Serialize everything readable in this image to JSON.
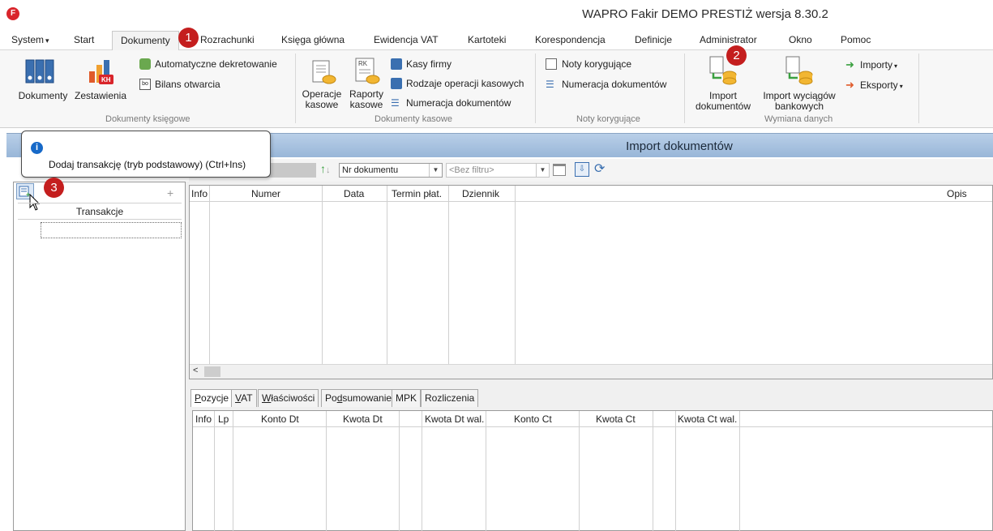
{
  "window": {
    "title": "WAPRO Fakir DEMO PRESTIŻ wersja 8.30.2"
  },
  "menu": {
    "items": [
      "System",
      "Start",
      "Dokumenty",
      "Rozrachunki",
      "Księga główna",
      "Ewidencja VAT",
      "Kartoteki",
      "Korespondencja",
      "Definicje",
      "Administrator",
      "Okno",
      "Pomoc"
    ],
    "system_arrow": "▾"
  },
  "ribbon": {
    "dokumenty_ksiegowe": {
      "label": "Dokumenty księgowe",
      "btn_dokumenty": "Dokumenty",
      "btn_zestawienia": "Zestawienia",
      "auto_dekretowanie": "Automatyczne dekretowanie",
      "bilans_otwarcia": "Bilans otwarcia"
    },
    "dokumenty_kasowe": {
      "label": "Dokumenty kasowe",
      "btn_operacje": "Operacje kasowe",
      "btn_raporty": "Raporty kasowe",
      "kasy_firmy": "Kasy firmy",
      "rodzaje_operacji": "Rodzaje operacji kasowych",
      "numeracja": "Numeracja dokumentów"
    },
    "noty": {
      "label": "Noty korygujące",
      "noty_korygujace": "Noty korygujące",
      "numeracja": "Numeracja dokumentów"
    },
    "wymiana": {
      "label": "Wymiana danych",
      "btn_import_dok": "Import dokumentów",
      "btn_import_wyciagow": "Import wyciągów bankowych",
      "importy": "Importy",
      "eksporty": "Eksporty"
    }
  },
  "panel": {
    "title": "Import dokumentów"
  },
  "tooltip": {
    "text": "Dodaj transakcję (tryb podstawowy) (Ctrl+Ins)"
  },
  "filter": {
    "sort_field": "Nr dokumentu",
    "filter_placeholder": "<Bez filtru>"
  },
  "left_pane": {
    "header": "Transakcje",
    "plus": "+"
  },
  "grid_top": {
    "columns": [
      "Info",
      "Numer",
      "Data",
      "Termin płat.",
      "Dziennik",
      "Opis"
    ]
  },
  "tabs": [
    {
      "pre": "",
      "u": "P",
      "post": "ozycje"
    },
    {
      "pre": "",
      "u": "V",
      "post": "AT"
    },
    {
      "pre": "",
      "u": "W",
      "post": "łaściwości"
    },
    {
      "pre": "Po",
      "u": "d",
      "post": "sumowanie"
    },
    {
      "pre": "MPK",
      "u": "",
      "post": ""
    },
    {
      "pre": "Rozliczenia",
      "u": "",
      "post": ""
    }
  ],
  "grid_bottom": {
    "columns": [
      "Info",
      "Lp",
      "Konto Dt",
      "Kwota Dt",
      "Kwota Dt wal.",
      "Konto Ct",
      "Kwota Ct",
      "Kwota Ct wal."
    ]
  },
  "callouts": [
    "1",
    "2",
    "3"
  ],
  "colors": {
    "callout": "#c41e1e",
    "panel_header": "#a9c3e2",
    "accent": "#1769c8"
  }
}
